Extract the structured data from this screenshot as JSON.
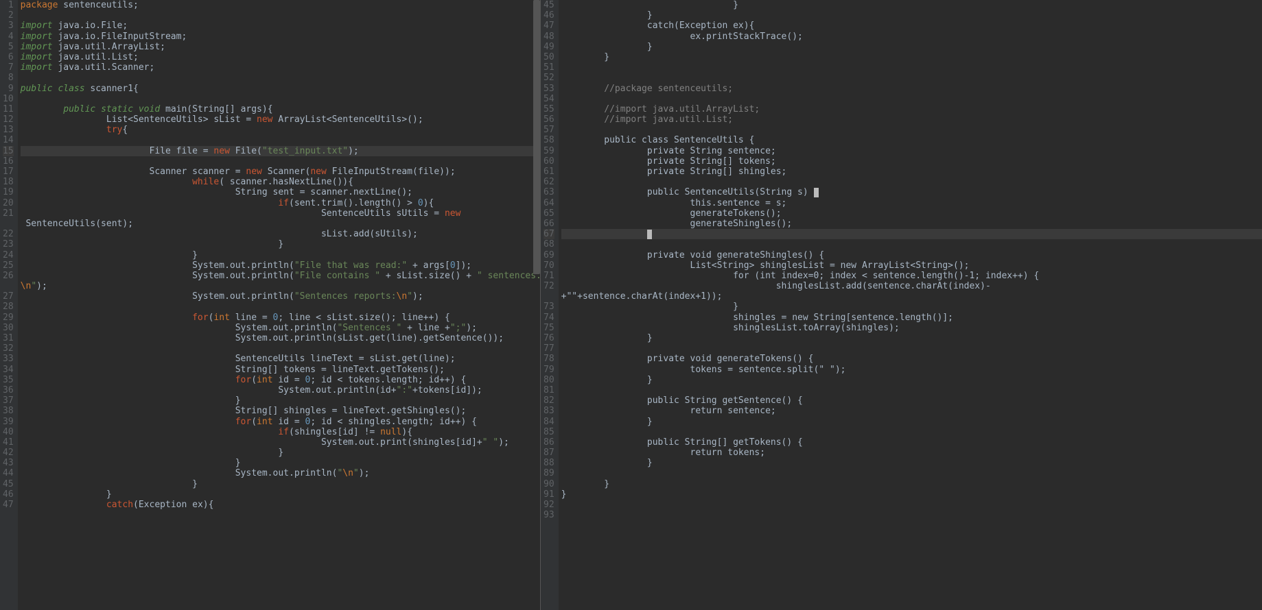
{
  "left": {
    "startLine": 1,
    "lines": [
      {
        "n": 1,
        "tokens": [
          {
            "t": "package",
            "c": "kw"
          },
          {
            "t": " sentenceutils;"
          }
        ]
      },
      {
        "n": 2,
        "tokens": []
      },
      {
        "n": 3,
        "tokens": [
          {
            "t": "import",
            "c": "kw-green"
          },
          {
            "t": " java.io.File;"
          }
        ]
      },
      {
        "n": 4,
        "tokens": [
          {
            "t": "import",
            "c": "kw-green"
          },
          {
            "t": " java.io.FileInputStream;"
          }
        ]
      },
      {
        "n": 5,
        "tokens": [
          {
            "t": "import",
            "c": "kw-green"
          },
          {
            "t": " java.util.ArrayList;"
          }
        ]
      },
      {
        "n": 6,
        "tokens": [
          {
            "t": "import",
            "c": "kw-green"
          },
          {
            "t": " java.util.List;"
          }
        ]
      },
      {
        "n": 7,
        "tokens": [
          {
            "t": "import",
            "c": "kw-green"
          },
          {
            "t": " java.util.Scanner;"
          }
        ]
      },
      {
        "n": 8,
        "tokens": []
      },
      {
        "n": 9,
        "tokens": [
          {
            "t": "public class",
            "c": "kw-green"
          },
          {
            "t": " scanner1{"
          }
        ]
      },
      {
        "n": 10,
        "tokens": []
      },
      {
        "n": 11,
        "tokens": [
          {
            "t": "        "
          },
          {
            "t": "public static void",
            "c": "kw-green"
          },
          {
            "t": " main(String[] args){"
          }
        ]
      },
      {
        "n": 12,
        "tokens": [
          {
            "t": "                List<SentenceUtils> sList = "
          },
          {
            "t": "new",
            "c": "kw-red"
          },
          {
            "t": " ArrayList<SentenceUtils>();"
          }
        ]
      },
      {
        "n": 13,
        "tokens": [
          {
            "t": "                "
          },
          {
            "t": "try",
            "c": "kw-red"
          },
          {
            "t": "{"
          }
        ]
      },
      {
        "n": 14,
        "tokens": []
      },
      {
        "n": 15,
        "current": true,
        "tokens": [
          {
            "t": "                        File file = "
          },
          {
            "t": "new",
            "c": "kw-red"
          },
          {
            "t": " File("
          },
          {
            "t": "\"test_input.txt\"",
            "c": "str"
          },
          {
            "t": ");"
          }
        ]
      },
      {
        "n": 16,
        "tokens": []
      },
      {
        "n": 17,
        "tokens": [
          {
            "t": "                        Scanner scanner = "
          },
          {
            "t": "new",
            "c": "kw-red"
          },
          {
            "t": " Scanner("
          },
          {
            "t": "new",
            "c": "kw-red"
          },
          {
            "t": " FileInputStream(file));"
          }
        ]
      },
      {
        "n": 18,
        "tokens": [
          {
            "t": "                                "
          },
          {
            "t": "while",
            "c": "kw-red"
          },
          {
            "t": "( scanner.hasNextLine()){"
          }
        ]
      },
      {
        "n": 19,
        "tokens": [
          {
            "t": "                                        String sent = scanner.nextLine();"
          }
        ]
      },
      {
        "n": 20,
        "tokens": [
          {
            "t": "                                                "
          },
          {
            "t": "if",
            "c": "kw-red"
          },
          {
            "t": "(sent.trim().length() > "
          },
          {
            "t": "0",
            "c": "num"
          },
          {
            "t": "){"
          }
        ]
      },
      {
        "n": 21,
        "tokens": [
          {
            "t": "                                                        SentenceUtils sUtils = "
          },
          {
            "t": "new",
            "c": "kw-red"
          }
        ]
      },
      {
        "n": "",
        "tokens": [
          {
            "t": " SentenceUtils(sent);"
          }
        ]
      },
      {
        "n": 22,
        "tokens": [
          {
            "t": "                                                        sList.add(sUtils);"
          }
        ]
      },
      {
        "n": 23,
        "tokens": [
          {
            "t": "                                                }"
          }
        ]
      },
      {
        "n": 24,
        "tokens": [
          {
            "t": "                                }"
          }
        ]
      },
      {
        "n": 25,
        "tokens": [
          {
            "t": "                                System.out.println("
          },
          {
            "t": "\"File that was read:\"",
            "c": "str"
          },
          {
            "t": " + args["
          },
          {
            "t": "0",
            "c": "num"
          },
          {
            "t": "]);"
          }
        ]
      },
      {
        "n": 26,
        "tokens": [
          {
            "t": "                                System.out.println("
          },
          {
            "t": "\"File contains \"",
            "c": "str"
          },
          {
            "t": " + sList.size() + "
          },
          {
            "t": "\" sentences.",
            "c": "str"
          }
        ]
      },
      {
        "n": "",
        "tokens": [
          {
            "t": "\\n",
            "c": "esc"
          },
          {
            "t": "\"",
            "c": "str"
          },
          {
            "t": ");"
          }
        ]
      },
      {
        "n": 27,
        "tokens": [
          {
            "t": "                                System.out.println("
          },
          {
            "t": "\"Sentences reports:",
            "c": "str"
          },
          {
            "t": "\\n",
            "c": "esc"
          },
          {
            "t": "\"",
            "c": "str"
          },
          {
            "t": ");"
          }
        ]
      },
      {
        "n": 28,
        "tokens": []
      },
      {
        "n": 29,
        "tokens": [
          {
            "t": "                                "
          },
          {
            "t": "for",
            "c": "kw-for"
          },
          {
            "t": "("
          },
          {
            "t": "int",
            "c": "kw"
          },
          {
            "t": " line = "
          },
          {
            "t": "0",
            "c": "num"
          },
          {
            "t": "; line < sList.size(); line++) {"
          }
        ]
      },
      {
        "n": 30,
        "tokens": [
          {
            "t": "                                        System.out.println("
          },
          {
            "t": "\"Sentences \"",
            "c": "str"
          },
          {
            "t": " + line +"
          },
          {
            "t": "\";\"",
            "c": "str"
          },
          {
            "t": ");"
          }
        ]
      },
      {
        "n": 31,
        "tokens": [
          {
            "t": "                                        System.out.println(sList.get(line).getSentence());"
          }
        ]
      },
      {
        "n": 32,
        "tokens": []
      },
      {
        "n": 33,
        "tokens": [
          {
            "t": "                                        SentenceUtils lineText = sList.get(line);"
          }
        ]
      },
      {
        "n": 34,
        "tokens": [
          {
            "t": "                                        String[] tokens = lineText.getTokens();"
          }
        ]
      },
      {
        "n": 35,
        "tokens": [
          {
            "t": "                                        "
          },
          {
            "t": "for",
            "c": "kw-for"
          },
          {
            "t": "("
          },
          {
            "t": "int",
            "c": "kw"
          },
          {
            "t": " id = "
          },
          {
            "t": "0",
            "c": "num"
          },
          {
            "t": "; id < tokens.length; id++) {"
          }
        ]
      },
      {
        "n": 36,
        "tokens": [
          {
            "t": "                                                System.out.println(id+"
          },
          {
            "t": "\":\"",
            "c": "str"
          },
          {
            "t": "+tokens[id]);"
          }
        ]
      },
      {
        "n": 37,
        "tokens": [
          {
            "t": "                                        }"
          }
        ]
      },
      {
        "n": 38,
        "tokens": [
          {
            "t": "                                        String[] shingles = lineText.getShingles();"
          }
        ]
      },
      {
        "n": 39,
        "tokens": [
          {
            "t": "                                        "
          },
          {
            "t": "for",
            "c": "kw-for"
          },
          {
            "t": "("
          },
          {
            "t": "int",
            "c": "kw"
          },
          {
            "t": " id = "
          },
          {
            "t": "0",
            "c": "num"
          },
          {
            "t": "; id < shingles.length; id++) {"
          }
        ]
      },
      {
        "n": 40,
        "tokens": [
          {
            "t": "                                                "
          },
          {
            "t": "if",
            "c": "kw-red"
          },
          {
            "t": "(shingles[id] != "
          },
          {
            "t": "null",
            "c": "kw"
          },
          {
            "t": "){"
          }
        ]
      },
      {
        "n": 41,
        "tokens": [
          {
            "t": "                                                        System.out.print(shingles[id]+"
          },
          {
            "t": "\" \"",
            "c": "str"
          },
          {
            "t": ");"
          }
        ]
      },
      {
        "n": 42,
        "tokens": [
          {
            "t": "                                                }"
          }
        ]
      },
      {
        "n": 43,
        "tokens": [
          {
            "t": "                                        }"
          }
        ]
      },
      {
        "n": 44,
        "tokens": [
          {
            "t": "                                        System.out.println("
          },
          {
            "t": "\"",
            "c": "str"
          },
          {
            "t": "\\n",
            "c": "esc"
          },
          {
            "t": "\"",
            "c": "str"
          },
          {
            "t": ");"
          }
        ]
      },
      {
        "n": 45,
        "tokens": [
          {
            "t": "                                }"
          }
        ]
      },
      {
        "n": 46,
        "tokens": [
          {
            "t": "                }"
          }
        ]
      },
      {
        "n": 47,
        "tokens": [
          {
            "t": "                "
          },
          {
            "t": "catch",
            "c": "kw-red"
          },
          {
            "t": "(Exception ex){"
          }
        ]
      }
    ]
  },
  "right": {
    "lines": [
      {
        "n": 45,
        "tokens": [
          {
            "t": "                                }"
          }
        ]
      },
      {
        "n": 46,
        "tokens": [
          {
            "t": "                }"
          }
        ]
      },
      {
        "n": 47,
        "tokens": [
          {
            "t": "                catch(Exception ex){"
          }
        ]
      },
      {
        "n": 48,
        "tokens": [
          {
            "t": "                        ex.printStackTrace();"
          }
        ]
      },
      {
        "n": 49,
        "tokens": [
          {
            "t": "                }"
          }
        ]
      },
      {
        "n": 50,
        "tokens": [
          {
            "t": "        }"
          }
        ]
      },
      {
        "n": 51,
        "tokens": []
      },
      {
        "n": 52,
        "tokens": []
      },
      {
        "n": 53,
        "tokens": [
          {
            "t": "        //package sentenceutils;",
            "c": "comment"
          }
        ]
      },
      {
        "n": 54,
        "tokens": []
      },
      {
        "n": 55,
        "tokens": [
          {
            "t": "        //import java.util.ArrayList;",
            "c": "comment"
          }
        ]
      },
      {
        "n": 56,
        "tokens": [
          {
            "t": "        //import java.util.List;",
            "c": "comment"
          }
        ]
      },
      {
        "n": 57,
        "tokens": []
      },
      {
        "n": 58,
        "tokens": [
          {
            "t": "        public class SentenceUtils {"
          }
        ]
      },
      {
        "n": 59,
        "tokens": [
          {
            "t": "                private String sentence;"
          }
        ]
      },
      {
        "n": 60,
        "tokens": [
          {
            "t": "                private String[] tokens;"
          }
        ]
      },
      {
        "n": 61,
        "tokens": [
          {
            "t": "                private String[] shingles;"
          }
        ]
      },
      {
        "n": 62,
        "tokens": []
      },
      {
        "n": 63,
        "tokens": [
          {
            "t": "                public SentenceUtils(String s) "
          },
          {
            "t": "",
            "cursor": true
          }
        ]
      },
      {
        "n": 64,
        "tokens": [
          {
            "t": "                        this.sentence = s;"
          }
        ]
      },
      {
        "n": 65,
        "tokens": [
          {
            "t": "                        generateTokens();"
          }
        ]
      },
      {
        "n": 66,
        "tokens": [
          {
            "t": "                        generateShingles();"
          }
        ]
      },
      {
        "n": 67,
        "current": true,
        "tokens": [
          {
            "t": "                "
          },
          {
            "t": "",
            "cursor": true
          }
        ]
      },
      {
        "n": 68,
        "tokens": []
      },
      {
        "n": 69,
        "tokens": [
          {
            "t": "                private void generateShingles() {"
          }
        ]
      },
      {
        "n": 70,
        "tokens": [
          {
            "t": "                        List<String> shinglesList = new ArrayList<String>();"
          }
        ]
      },
      {
        "n": 71,
        "tokens": [
          {
            "t": "                                for (int index=0; index < sentence.length()-1; index++) {"
          }
        ]
      },
      {
        "n": 72,
        "tokens": [
          {
            "t": "                                        shinglesList.add(sentence.charAt(index)-"
          }
        ]
      },
      {
        "n": "",
        "tokens": [
          {
            "t": "+\"\"+sentence.charAt(index+1));"
          }
        ]
      },
      {
        "n": 73,
        "tokens": [
          {
            "t": "                                }"
          }
        ]
      },
      {
        "n": 74,
        "tokens": [
          {
            "t": "                                shingles = new String[sentence.length()];"
          }
        ]
      },
      {
        "n": 75,
        "tokens": [
          {
            "t": "                                shinglesList.toArray(shingles);"
          }
        ]
      },
      {
        "n": 76,
        "tokens": [
          {
            "t": "                }"
          }
        ]
      },
      {
        "n": 77,
        "tokens": []
      },
      {
        "n": 78,
        "tokens": [
          {
            "t": "                private void generateTokens() {"
          }
        ]
      },
      {
        "n": 79,
        "tokens": [
          {
            "t": "                        tokens = sentence.split(\" \");"
          }
        ]
      },
      {
        "n": 80,
        "tokens": [
          {
            "t": "                }"
          }
        ]
      },
      {
        "n": 81,
        "tokens": []
      },
      {
        "n": 82,
        "tokens": [
          {
            "t": "                public String getSentence() {"
          }
        ]
      },
      {
        "n": 83,
        "tokens": [
          {
            "t": "                        return sentence;"
          }
        ]
      },
      {
        "n": 84,
        "tokens": [
          {
            "t": "                }"
          }
        ]
      },
      {
        "n": 85,
        "tokens": []
      },
      {
        "n": 86,
        "tokens": [
          {
            "t": "                public String[] getTokens() {"
          }
        ]
      },
      {
        "n": 87,
        "tokens": [
          {
            "t": "                        return tokens;"
          }
        ]
      },
      {
        "n": 88,
        "tokens": [
          {
            "t": "                }"
          }
        ]
      },
      {
        "n": 89,
        "tokens": []
      },
      {
        "n": 90,
        "tokens": [
          {
            "t": "        }"
          }
        ]
      },
      {
        "n": 91,
        "tokens": [
          {
            "t": "}"
          }
        ]
      },
      {
        "n": 92,
        "tokens": []
      },
      {
        "n": 93,
        "tokens": []
      }
    ]
  }
}
